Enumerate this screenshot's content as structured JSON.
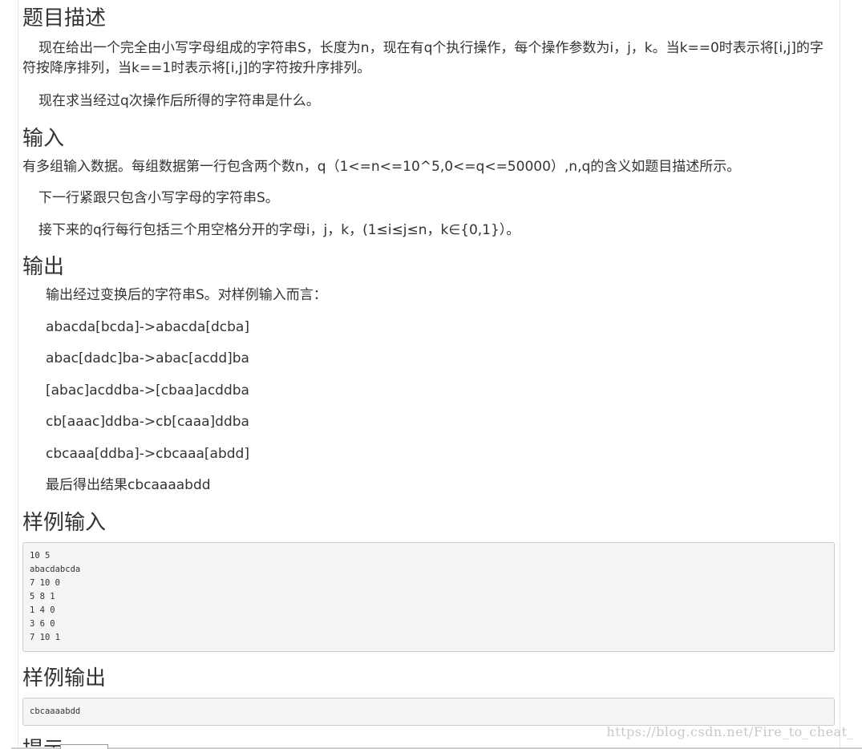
{
  "sections": {
    "description": {
      "heading": "题目描述",
      "p1": "现在给出一个完全由小写字母组成的字符串S，长度为n，现在有q个执行操作，每个操作参数为i，j，k。当k==0时表示将[i,j]的字符按降序排列，当k==1时表示将[i,j]的字符按升序排列。",
      "p2": "现在求当经过q次操作后所得的字符串是什么。"
    },
    "input": {
      "heading": "输入",
      "p1": "有多组输入数据。每组数据第一行包含两个数n，q（1<=n<=10^5,0<=q<=50000）,n,q的含义如题目描述所示。",
      "p2": "下一行紧跟只包含小写字母的字符串S。",
      "p3": "接下来的q行每行包括三个用空格分开的字母i，j，k，(1≤i≤j≤n，k∈{0,1}）。"
    },
    "output": {
      "heading": "输出",
      "lines": [
        "输出经过变换后的字符串S。对样例输入而言：",
        "abacda[bcda]->abacda[dcba]",
        "abac[dadc]ba->abac[acdd]ba",
        "[abac]acddba->[cbaa]acddba",
        "cb[aaac]ddba->cb[caaa]ddba",
        "cbcaaa[ddba]->cbcaaa[abdd]",
        "最后得出结果cbcaaaabdd"
      ]
    },
    "sample_input": {
      "heading": "样例输入",
      "lines": [
        "10 5",
        "abacdabcda",
        "7 10 0",
        "5 8 1",
        "1 4 0",
        "3 6 0",
        "7 10 1"
      ]
    },
    "sample_output": {
      "heading": "样例输出",
      "lines": [
        "cbcaaaabdd"
      ]
    },
    "hint": {
      "heading": "提示"
    }
  },
  "watermark": "https://blog.csdn.net/Fire_to_cheat_",
  "colors": {
    "text": "#333333",
    "pre_background": "#f5f5f5",
    "pre_border": "#cccccc",
    "watermark": "#c8c8c8"
  }
}
